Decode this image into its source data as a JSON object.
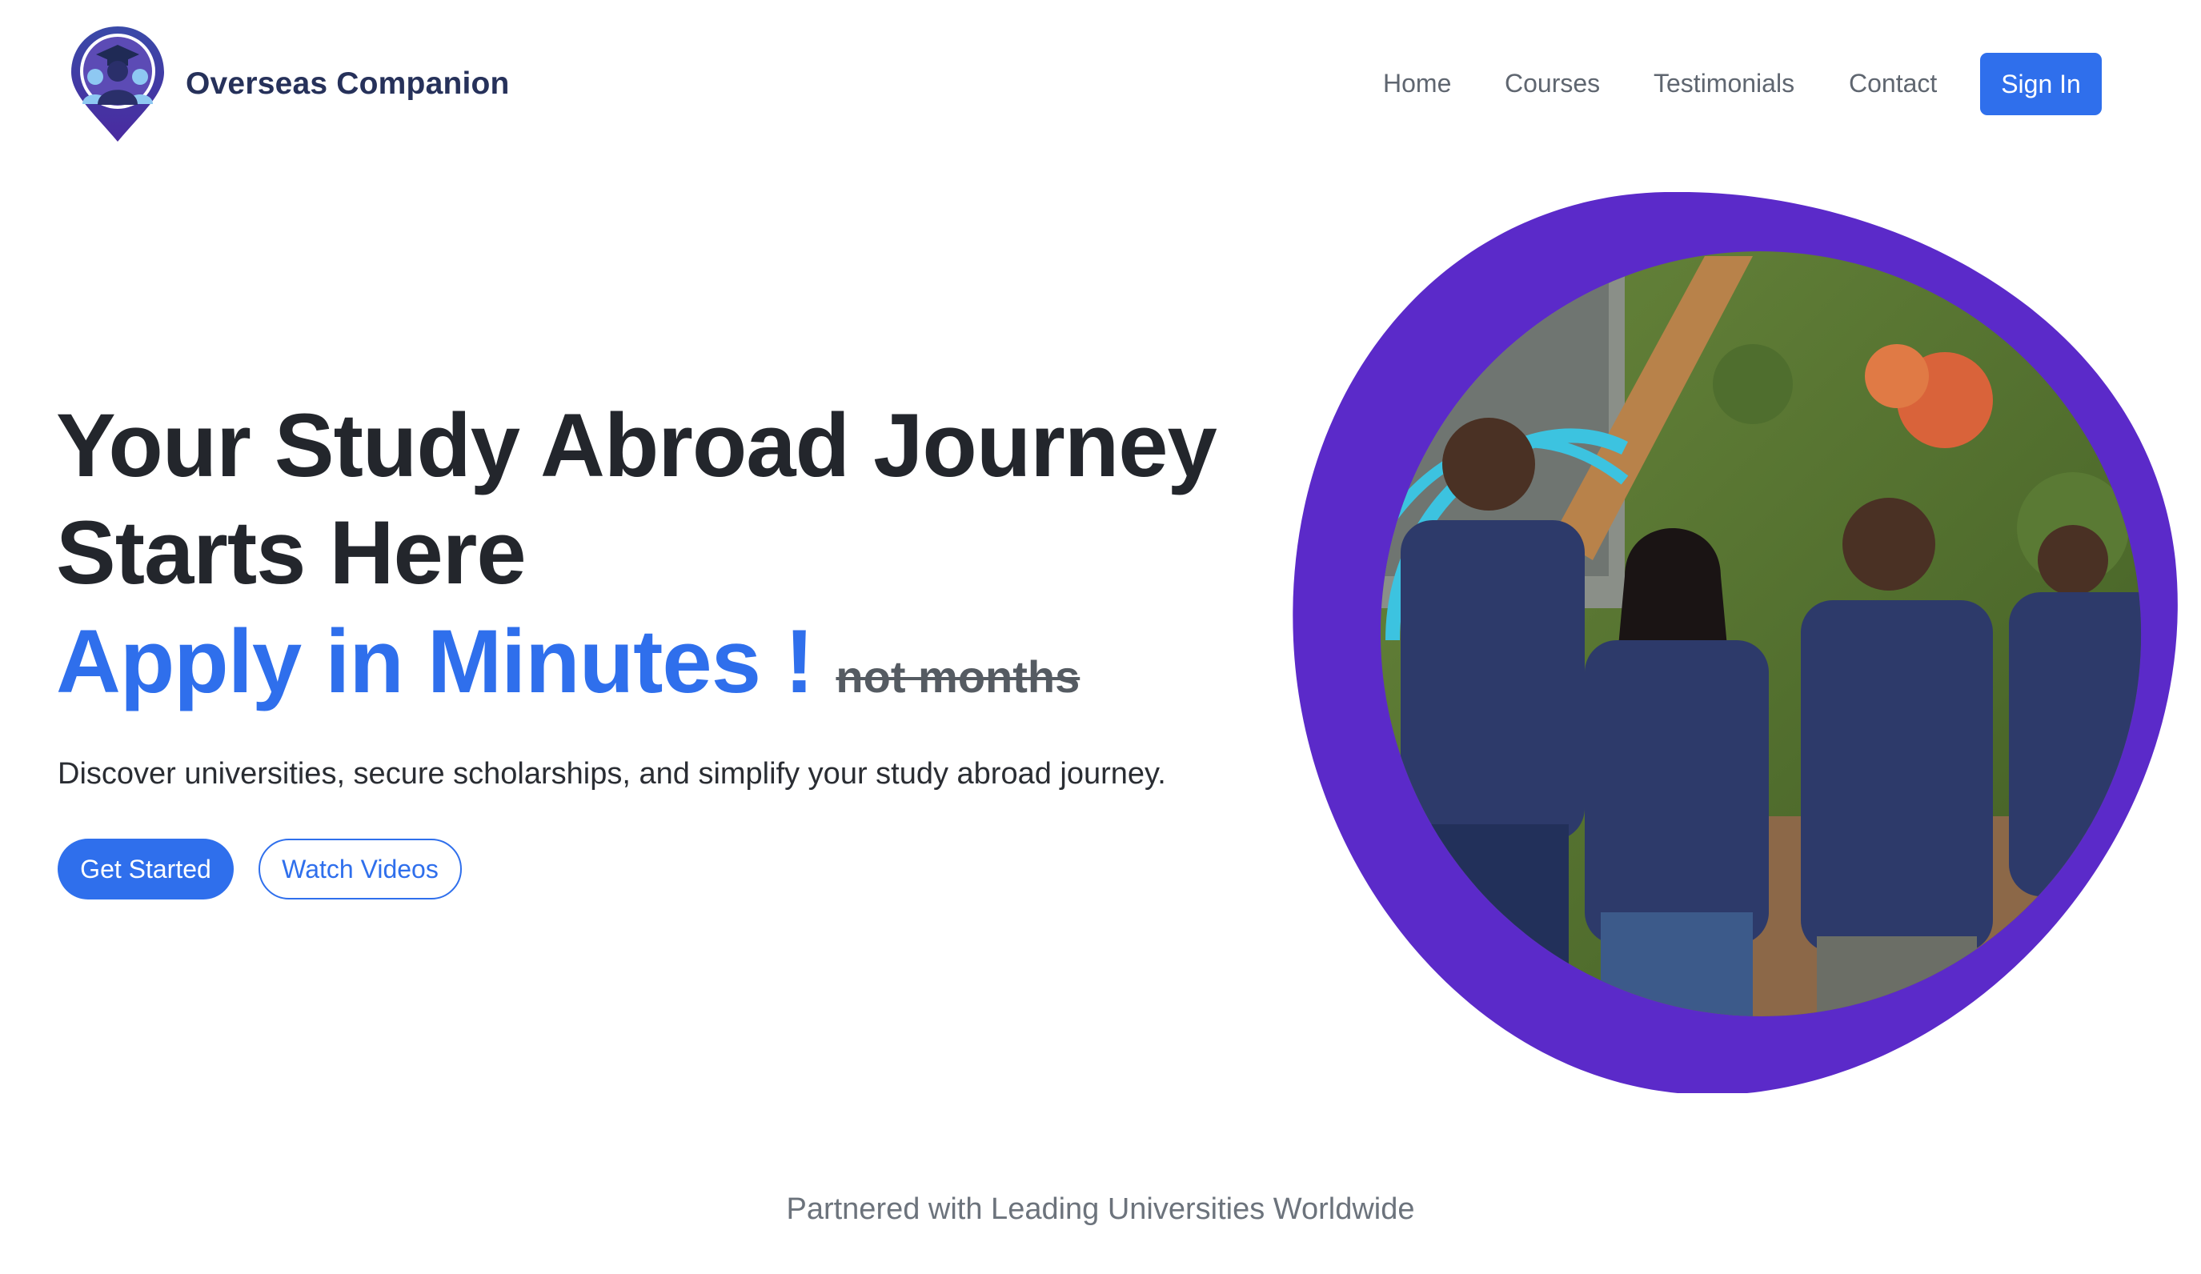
{
  "header": {
    "brand_name": "Overseas Companion",
    "nav": [
      "Home",
      "Courses",
      "Testimonials",
      "Contact"
    ],
    "sign_in": "Sign In"
  },
  "hero": {
    "title": "Your Study Abroad Journey Starts Here",
    "apply": "Apply in Minutes !",
    "strike": "not months",
    "lead": "Discover universities, secure scholarships, and simplify your study abroad journey.",
    "get_started": "Get Started",
    "watch_videos": "Watch Videos"
  },
  "partners": {
    "text": "Partnered with Leading Universities Worldwide"
  },
  "colors": {
    "accent": "#2f6fec",
    "purple": "#5b2ac9",
    "brand_text": "#26315a"
  }
}
